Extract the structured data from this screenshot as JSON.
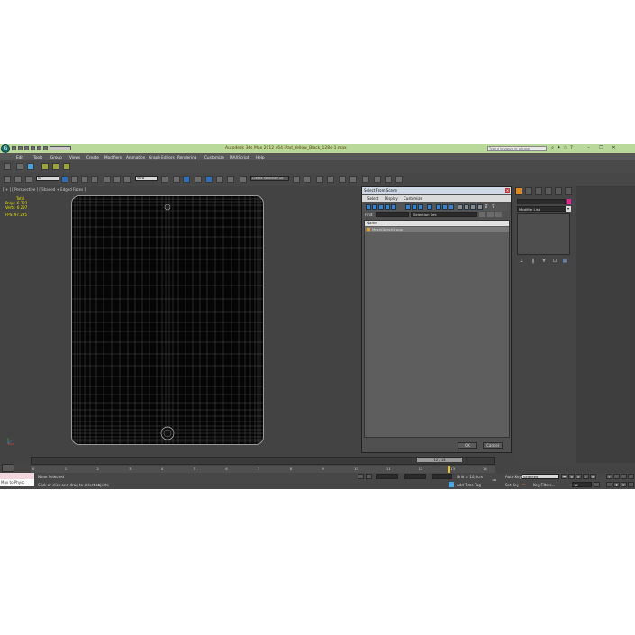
{
  "app": {
    "title": "Autodesk 3ds Max 2012 x64      iPad_Yellow_Black_1284-1.max",
    "search_placeholder": "Type a keyword or phrase",
    "logo": "3ds-max-logo"
  },
  "menu": [
    "Edit",
    "Tools",
    "Group",
    "Views",
    "Create",
    "Modifiers",
    "Animation",
    "Graph Editors",
    "Rendering",
    "Customize",
    "MAXScript",
    "Help"
  ],
  "toolbar": {
    "selection_filter": "All",
    "reference_coord": "View",
    "named_selection": "Create Selection Se"
  },
  "viewport": {
    "label": "[ + ] [ Perspective ] [ Shaded + Edged Faces ]",
    "stats": {
      "total_label": "Total",
      "polys_label": "Polys:",
      "polys_value": "6 722",
      "verts_label": "Verts:",
      "verts_value": "6 297",
      "fps_label": "FPS:",
      "fps_value": "97.295"
    }
  },
  "dialog": {
    "title": "Select From Scene",
    "menu": [
      "Select",
      "Display",
      "Customize"
    ],
    "find_label": "Find:",
    "selection_set_label": "Selection Set:",
    "column_name": "Name",
    "rows": [
      "MeshObjectGroup"
    ],
    "ok_label": "OK",
    "cancel_label": "Cancel"
  },
  "command_panel": {
    "modifier_list": "Modifier List",
    "accent_color": "#e0288c"
  },
  "timeline": {
    "frame_indicator": "12 / 14",
    "ticks": [
      "0",
      "1",
      "2",
      "3",
      "4",
      "5",
      "6",
      "7",
      "8",
      "9",
      "10",
      "11",
      "12",
      "13",
      "14"
    ]
  },
  "status": {
    "maxscript_label": "Max to Physc",
    "selection_status": "None Selected",
    "prompt": "Click or click-and-drag to select objects",
    "grid": "Grid = 10,0cm",
    "add_time_tag": "Add Time Tag",
    "auto_key": "Auto Key",
    "auto_key_value": "Selected",
    "set_key": "Set Key",
    "key_filters": "Key Filters...",
    "frame_value": "12"
  }
}
